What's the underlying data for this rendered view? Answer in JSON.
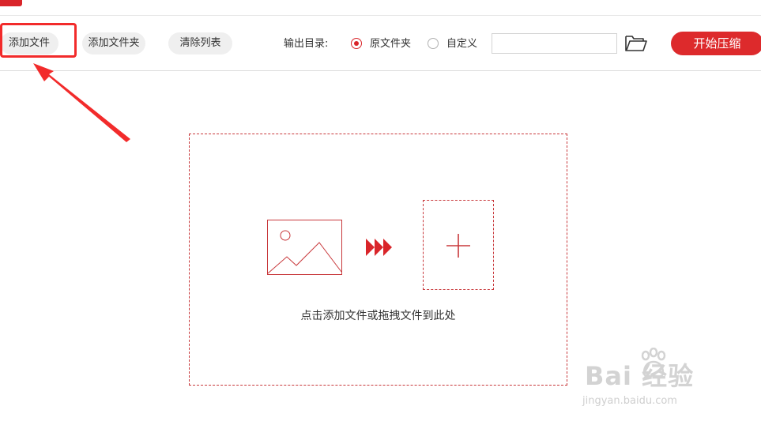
{
  "toolbar": {
    "add_file_label": "添加文件",
    "add_folder_label": "添加文件夹",
    "clear_list_label": "清除列表",
    "output_dir_label": "输出目录:",
    "output_options": [
      "原文件夹",
      "自定义"
    ],
    "output_selected": "原文件夹",
    "path_value": "",
    "folder_icon": "folder-open-icon",
    "start_label": "开始压缩"
  },
  "drop_area": {
    "hint": "点击添加文件或拖拽文件到此处",
    "image_icon": "image-icon",
    "arrow_icon": "triple-arrow-icon",
    "add_icon": "plus-icon"
  },
  "watermark": {
    "main": "Bai 经验",
    "sub": "jingyan.baidu.com"
  },
  "colors": {
    "accent": "#dd2a2c",
    "annotation": "#f22b2b",
    "pill_bg": "#efefef",
    "watermark": "#d3d3d3"
  }
}
